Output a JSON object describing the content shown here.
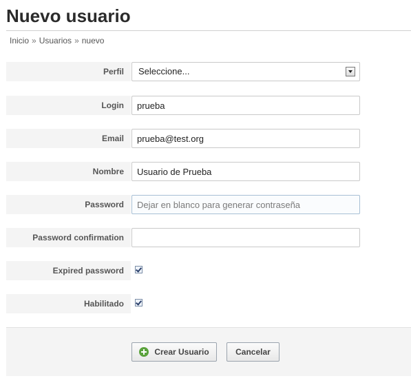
{
  "page": {
    "title": "Nuevo usuario"
  },
  "breadcrumb": {
    "items": [
      "Inicio",
      "Usuarios",
      "nuevo"
    ],
    "separator": "»"
  },
  "form": {
    "perfil": {
      "label": "Perfil",
      "value": "Seleccione..."
    },
    "login": {
      "label": "Login",
      "value": "prueba"
    },
    "email": {
      "label": "Email",
      "value": "prueba@test.org"
    },
    "nombre": {
      "label": "Nombre",
      "value": "Usuario de Prueba"
    },
    "password": {
      "label": "Password",
      "value": "",
      "placeholder": "Dejar en blanco para generar contraseña"
    },
    "password_confirmation": {
      "label": "Password confirmation",
      "value": ""
    },
    "expired_password": {
      "label": "Expired password",
      "checked": true
    },
    "habilitado": {
      "label": "Habilitado",
      "checked": true
    }
  },
  "actions": {
    "create_label": "Crear Usuario",
    "cancel_label": "Cancelar"
  },
  "colors": {
    "accent_green": "#5aa23c",
    "label_bg": "#f4f4f4",
    "focus_border": "#a7bfd4"
  }
}
